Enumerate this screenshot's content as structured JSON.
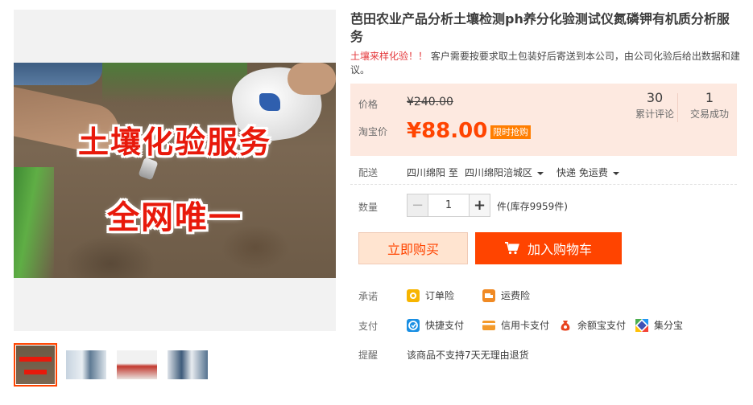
{
  "product": {
    "title": "芭田农业产品分析土壤检测ph养分化验测试仪氮磷钾有机质分析服务",
    "subtitle_alert": "土壤来样化验！！",
    "subtitle_rest": "客户需要按要求取土包装好后寄送到本公司，由公司化验后给出数据和建议。"
  },
  "gallery": {
    "banner_line1": "土壤化验服务",
    "banner_line2": "全网唯一",
    "thumbnails": [
      "thumb-1",
      "thumb-2",
      "thumb-3",
      "thumb-4"
    ],
    "active_thumbnail": 1
  },
  "price": {
    "original_label": "价格",
    "original_value": "¥240.00",
    "promo_label": "淘宝价",
    "promo_value": "¥88.00",
    "promo_badge": "限时抢购",
    "stats": [
      {
        "num": "30",
        "caption": "累计评论"
      },
      {
        "num": "1",
        "caption": "交易成功"
      }
    ]
  },
  "shipping": {
    "label": "配送",
    "from": "四川绵阳 至",
    "to": "四川绵阳涪城区",
    "method": "快递 免运费"
  },
  "quantity": {
    "label": "数量",
    "value": "1",
    "stock": "件(库存9959件)"
  },
  "actions": {
    "buy_now": "立即购买",
    "add_to_cart": "加入购物车"
  },
  "promise": {
    "label": "承诺",
    "items": [
      {
        "label": "订单险",
        "icon": "order-insurance-icon",
        "color": "#f7b500"
      },
      {
        "label": "运费险",
        "icon": "shipping-insurance-icon",
        "color": "#f08a24"
      }
    ]
  },
  "payment": {
    "label": "支付",
    "items": [
      {
        "label": "快捷支付",
        "icon": "quick-pay-icon",
        "color": "#1a8fe3"
      },
      {
        "label": "信用卡支付",
        "icon": "credit-card-icon",
        "color": "#f39a2b"
      },
      {
        "label": "余额宝支付",
        "icon": "yuebao-icon",
        "color": "#e8431f"
      },
      {
        "label": "集分宝",
        "icon": "jifenbao-icon",
        "color": "#4caf50"
      }
    ]
  },
  "reminder": {
    "label": "提醒",
    "text": "该商品不支持7天无理由退货"
  },
  "colors": {
    "accent": "#ff4400",
    "price_bg": "#fde9e0",
    "buy_now_bg": "#ffe4d0"
  }
}
